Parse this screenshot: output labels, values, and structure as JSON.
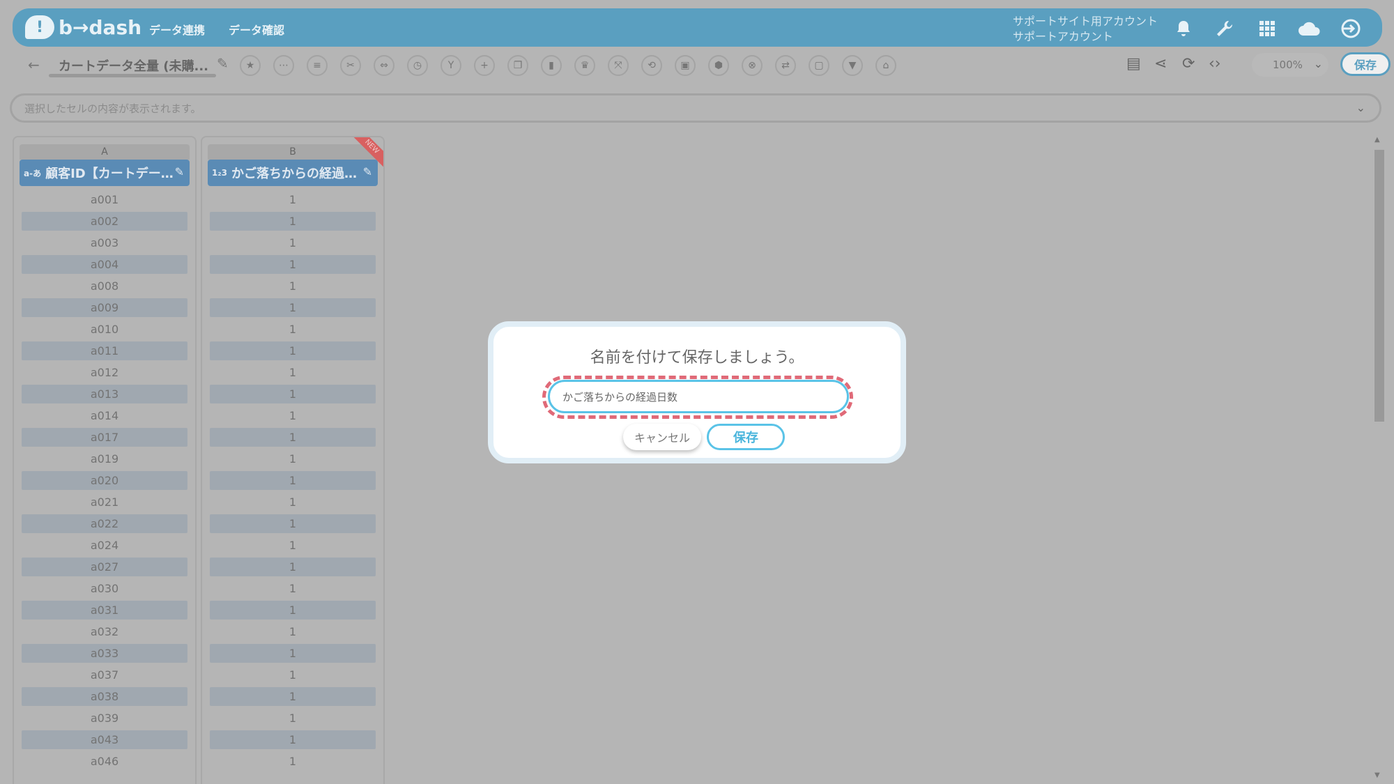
{
  "header": {
    "logo_text": "b→dash",
    "nav": [
      "データ連携",
      "データ確認"
    ],
    "account_line1": "サポートサイト用アカウント",
    "account_line2": "サポートアカウント",
    "icons": [
      "bell-icon",
      "wrench-icon",
      "grid-icon",
      "cloud-badge-icon",
      "logout-icon"
    ]
  },
  "toolbar": {
    "back_icon": "←",
    "title": "カートデータ全量 (未購...",
    "edit_icon": "✎",
    "tool_icons": [
      "star",
      "more",
      "list",
      "tools",
      "expand",
      "timer",
      "branch",
      "plus",
      "copy",
      "trash",
      "crown",
      "collapse",
      "loop",
      "lock",
      "box",
      "close-circle",
      "replace",
      "frame",
      "filter",
      "stamp"
    ],
    "right_icons": [
      "clipboard-icon",
      "share-icon",
      "refresh-icon",
      "code-icon"
    ],
    "zoom": "100%",
    "save_label": "保存"
  },
  "formula_bar": {
    "placeholder": "選択したセルの内容が表示されます。"
  },
  "columns": [
    {
      "letter": "A",
      "type_icon": "a-あ",
      "header": "顧客ID【カートデー…",
      "cells": [
        "a001",
        "a002",
        "a003",
        "a004",
        "a008",
        "a009",
        "a010",
        "a011",
        "a012",
        "a013",
        "a014",
        "a017",
        "a019",
        "a020",
        "a021",
        "a022",
        "a024",
        "a027",
        "a030",
        "a031",
        "a032",
        "a033",
        "a037",
        "a038",
        "a039",
        "a043",
        "a046"
      ]
    },
    {
      "letter": "B",
      "type_icon": "1₂3",
      "header": "かご落ちからの経過…",
      "badge": "NEW",
      "cells": [
        "1",
        "1",
        "1",
        "1",
        "1",
        "1",
        "1",
        "1",
        "1",
        "1",
        "1",
        "1",
        "1",
        "1",
        "1",
        "1",
        "1",
        "1",
        "1",
        "1",
        "1",
        "1",
        "1",
        "1",
        "1",
        "1",
        "1"
      ]
    }
  ],
  "modal": {
    "title": "名前を付けて保存しましょう。",
    "input_value": "かご落ちからの経過日数",
    "cancel_label": "キャンセル",
    "save_label": "保存"
  },
  "colors": {
    "brand": "#5a9fc0",
    "accent": "#5ac3e7",
    "highlight": "#e06a78"
  }
}
